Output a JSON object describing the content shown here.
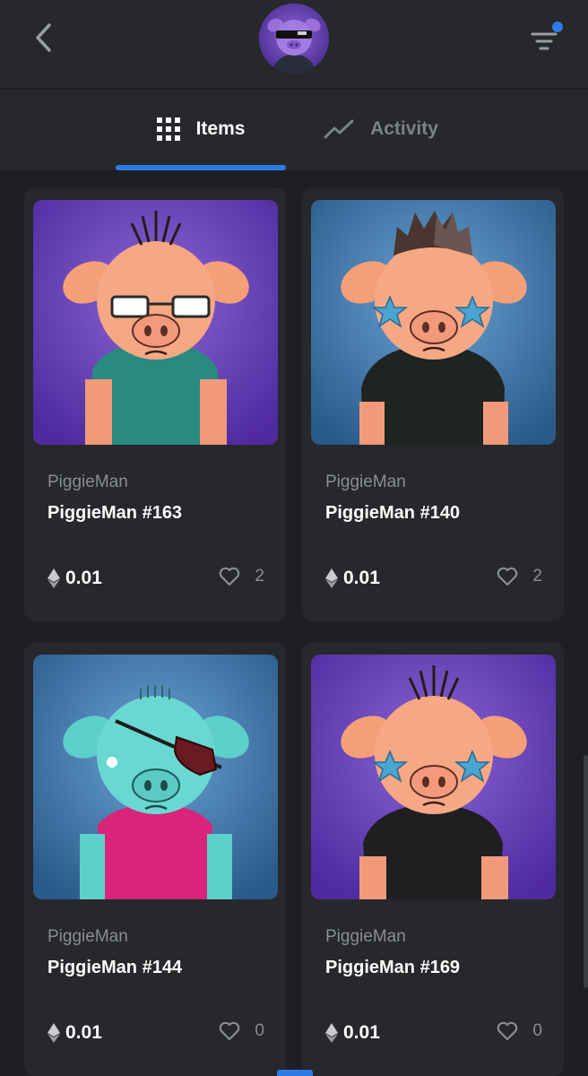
{
  "header": {
    "back_icon": "chevron-left-icon",
    "avatar_icon": "pig-avatar-icon",
    "filter_icon": "filter-icon",
    "filter_badge_color": "#2f7be6"
  },
  "tabs": [
    {
      "label": "Items",
      "icon": "grid-icon",
      "active": true
    },
    {
      "label": "Activity",
      "icon": "chart-line-icon",
      "active": false
    }
  ],
  "accent_color": "#2f7be6",
  "cards": [
    {
      "collection": "PiggieMan",
      "name": "PiggieMan #163",
      "price": "0.01",
      "likes": "2"
    },
    {
      "collection": "PiggieMan",
      "name": "PiggieMan #140",
      "price": "0.01",
      "likes": "2"
    },
    {
      "collection": "PiggieMan",
      "name": "PiggieMan #144",
      "price": "0.01",
      "likes": "0"
    },
    {
      "collection": "PiggieMan",
      "name": "PiggieMan #169",
      "price": "0.01",
      "likes": "0"
    }
  ]
}
